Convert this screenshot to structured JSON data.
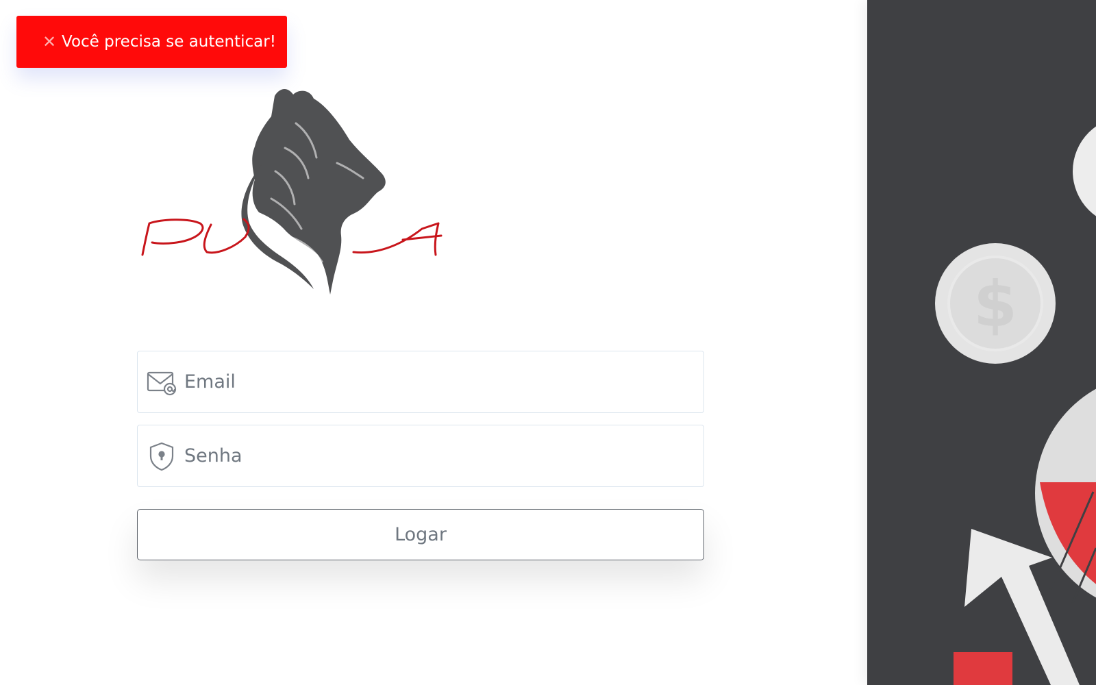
{
  "toast": {
    "message": "Você precisa se autenticar!",
    "icon": "close-icon"
  },
  "logo": {
    "text": "PUMA"
  },
  "form": {
    "email": {
      "placeholder": "Email",
      "value": "",
      "icon": "email-at-icon"
    },
    "password": {
      "placeholder": "Senha",
      "value": "",
      "icon": "shield-lock-icon"
    },
    "submit_label": "Logar"
  },
  "colors": {
    "error": "#ff0a0a",
    "brand_red": "#c8151b",
    "panel": "#3f4043",
    "coin": "#e4e4e4"
  }
}
